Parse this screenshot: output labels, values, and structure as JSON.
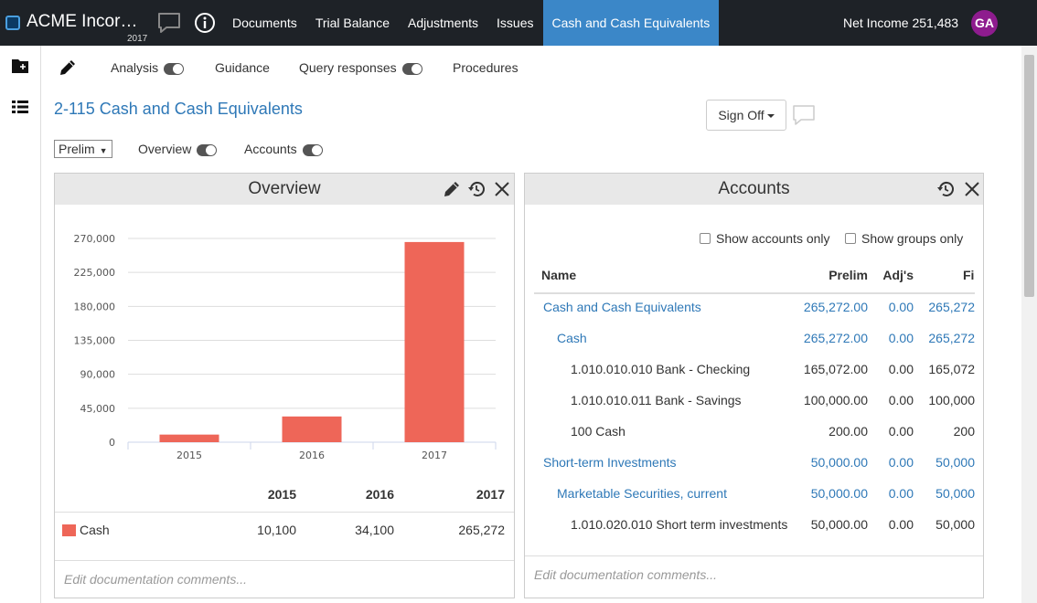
{
  "header": {
    "app_title": "ACME Incor…",
    "year": "2017",
    "nav": [
      "Documents",
      "Trial Balance",
      "Adjustments",
      "Issues",
      "Cash and Cash Equivalents"
    ],
    "active_nav": "Cash and Cash Equivalents",
    "net_income": "Net Income 251,483",
    "avatar_initials": "GA"
  },
  "toolbar": {
    "items": [
      "Analysis",
      "Guidance",
      "Query responses",
      "Procedures"
    ]
  },
  "page": {
    "title": "2-115 Cash and Cash Equivalents",
    "sign_off_label": "Sign Off",
    "prelim_select": "Prelim",
    "overview_toggle_label": "Overview",
    "accounts_toggle_label": "Accounts"
  },
  "overview": {
    "title": "Overview",
    "table_years": [
      "2015",
      "2016",
      "2017"
    ],
    "series_label": "Cash",
    "series_values_text": [
      "10,100",
      "34,100",
      "265,272"
    ],
    "comments_placeholder": "Edit documentation comments..."
  },
  "chart_data": {
    "type": "bar",
    "categories": [
      "2015",
      "2016",
      "2017"
    ],
    "series": [
      {
        "name": "Cash",
        "values": [
          10100,
          34100,
          265272
        ]
      }
    ],
    "ylim": [
      0,
      270000
    ],
    "yticks": [
      0,
      45000,
      90000,
      135000,
      180000,
      225000,
      270000
    ],
    "ytick_labels": [
      "0",
      "45,000",
      "90,000",
      "135,000",
      "180,000",
      "225,000",
      "270,000"
    ],
    "bar_color": "#ee6658",
    "grid": true
  },
  "accounts": {
    "title": "Accounts",
    "show_accounts_only": "Show accounts only",
    "show_groups_only": "Show groups only",
    "columns": [
      "Name",
      "Prelim",
      "Adj's",
      "Fi"
    ],
    "rows": [
      {
        "name": "Cash and Cash Equivalents",
        "prelim": "265,272.00",
        "adj": "0.00",
        "final": "265,272",
        "level": 0,
        "link": true
      },
      {
        "name": "Cash",
        "prelim": "265,272.00",
        "adj": "0.00",
        "final": "265,272",
        "level": 1,
        "link": true
      },
      {
        "name": "1.010.010.010 Bank - Checking",
        "prelim": "165,072.00",
        "adj": "0.00",
        "final": "165,072",
        "level": 2,
        "link": false
      },
      {
        "name": "1.010.010.011 Bank - Savings",
        "prelim": "100,000.00",
        "adj": "0.00",
        "final": "100,000",
        "level": 2,
        "link": false
      },
      {
        "name": "100 Cash",
        "prelim": "200.00",
        "adj": "0.00",
        "final": "200",
        "level": 2,
        "link": false
      },
      {
        "name": "Short-term Investments",
        "prelim": "50,000.00",
        "adj": "0.00",
        "final": "50,000",
        "level": 0,
        "link": true
      },
      {
        "name": "Marketable Securities, current",
        "prelim": "50,000.00",
        "adj": "0.00",
        "final": "50,000",
        "level": 1,
        "link": true
      },
      {
        "name": "1.010.020.010 Short term investments",
        "prelim": "50,000.00",
        "adj": "0.00",
        "final": "50,000",
        "level": 2,
        "link": false
      }
    ],
    "comments_placeholder": "Edit documentation comments..."
  },
  "colors": {
    "topbar": "#1e2227",
    "active_tab": "#3b87c8",
    "link": "#2e78b7",
    "avatar": "#8e1c8e",
    "bar": "#ee6658"
  }
}
